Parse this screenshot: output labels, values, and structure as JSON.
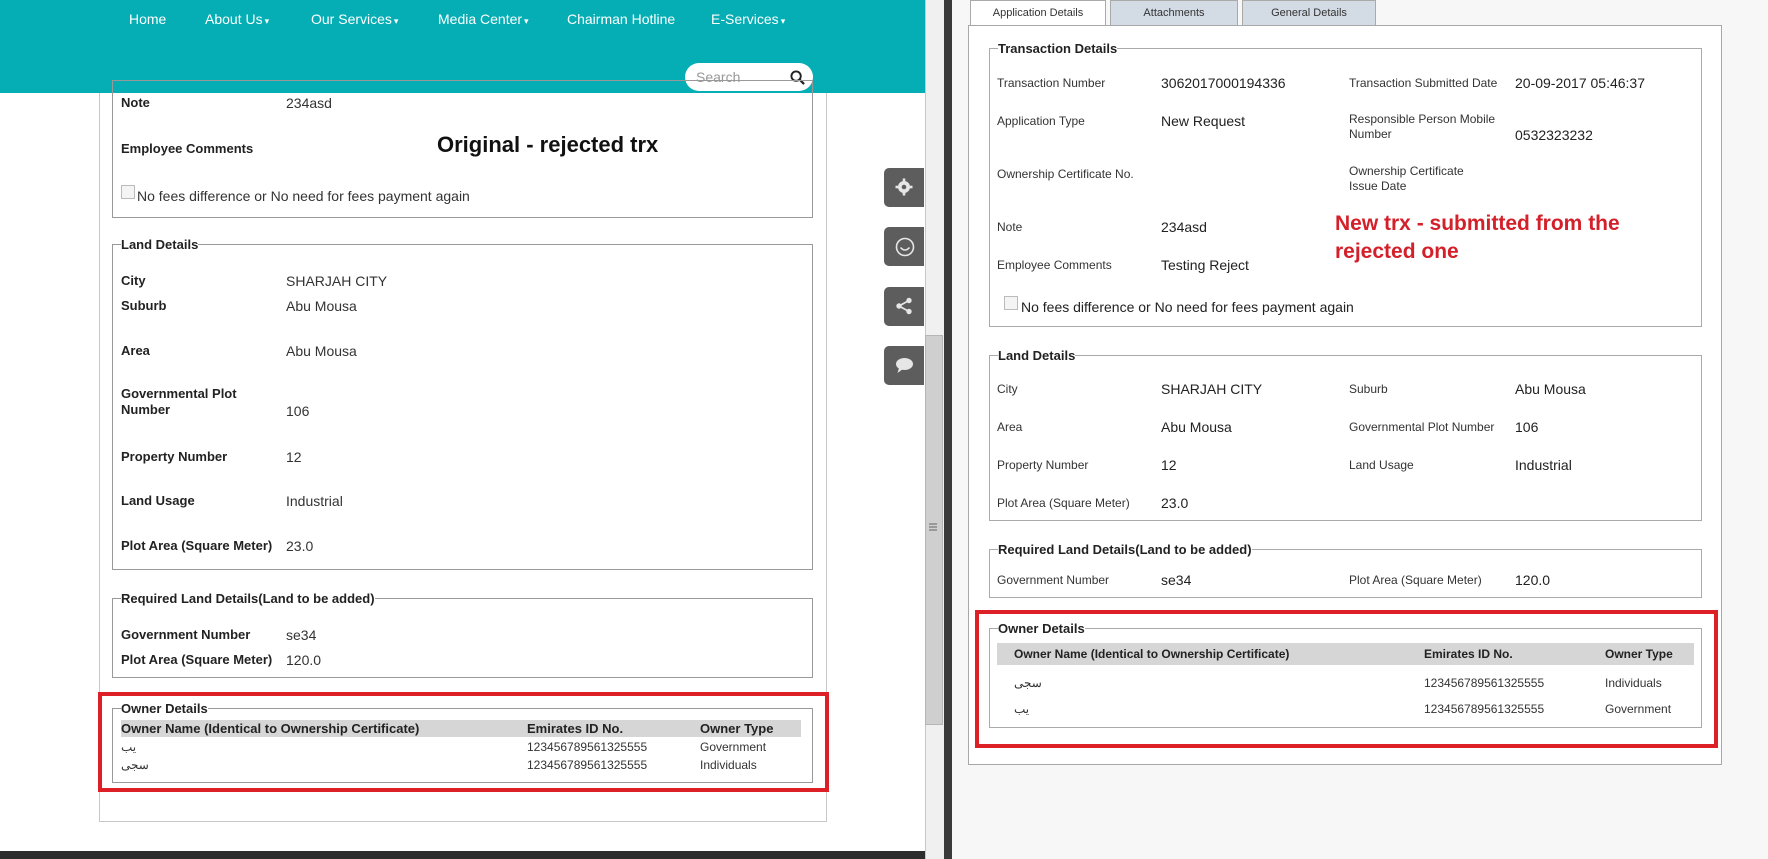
{
  "left": {
    "nav": {
      "items": [
        {
          "label": "Home",
          "caret": false
        },
        {
          "label": "About Us",
          "caret": true
        },
        {
          "label": "Our Services",
          "caret": true
        },
        {
          "label": "Media Center",
          "caret": true
        },
        {
          "label": "Chairman Hotline",
          "caret": false
        },
        {
          "label": "E-Services",
          "caret": true
        }
      ],
      "search_placeholder": "Search"
    },
    "app_section": {
      "note_label": "Note",
      "note_value": "234asd",
      "employee_comments_label": "Employee Comments",
      "fees_checkbox_label": "No fees difference or No need for fees payment again"
    },
    "annotation": "Original - rejected trx",
    "land_details": {
      "legend": "Land Details",
      "rows": [
        {
          "label": "City",
          "value": "SHARJAH CITY"
        },
        {
          "label": "Suburb",
          "value": "Abu Mousa"
        },
        {
          "label": "Area",
          "value": "Abu Mousa"
        },
        {
          "label": "Governmental Plot Number",
          "value": "106"
        },
        {
          "label": "Property Number",
          "value": "12"
        },
        {
          "label": "Land Usage",
          "value": "Industrial"
        },
        {
          "label": "Plot Area (Square Meter)",
          "value": "23.0"
        }
      ]
    },
    "required_land": {
      "legend": "Required Land Details(Land to be added)",
      "rows": [
        {
          "label": "Government Number",
          "value": "se34"
        },
        {
          "label": "Plot Area (Square Meter)",
          "value": "120.0"
        }
      ]
    },
    "owner_details": {
      "legend": "Owner Details",
      "columns": [
        "Owner Name (Identical to Ownership Certificate)",
        "Emirates ID No.",
        "Owner Type"
      ],
      "rows": [
        {
          "name": "يب",
          "id": "123456789561325555",
          "type": "Government"
        },
        {
          "name": "سجى",
          "id": "123456789561325555",
          "type": "Individuals"
        }
      ]
    }
  },
  "right": {
    "tabs": [
      "Application Details",
      "Attachments",
      "General Details"
    ],
    "transaction": {
      "legend": "Transaction Details",
      "transaction_number_label": "Transaction Number",
      "transaction_number": "3062017000194336",
      "submitted_date_label": "Transaction Submitted Date",
      "submitted_date": "20-09-2017 05:46:37",
      "application_type_label": "Application Type",
      "application_type": "New Request",
      "responsible_mobile_label": "Responsible Person Mobile Number",
      "responsible_mobile": "0532323232",
      "ownership_cert_label": "Ownership Certificate No.",
      "ownership_cert_date_label": "Ownership Certificate Issue Date",
      "note_label": "Note",
      "note_value": "234asd",
      "employee_comments_label": "Employee Comments",
      "employee_comments_value": "Testing Reject",
      "fees_checkbox_label": "No fees difference or No need for fees payment again"
    },
    "annotation": "New trx - submitted from the rejected one",
    "land_details": {
      "legend": "Land Details",
      "city_label": "City",
      "city": "SHARJAH CITY",
      "suburb_label": "Suburb",
      "suburb": "Abu Mousa",
      "area_label": "Area",
      "area": "Abu Mousa",
      "plot_number_label": "Governmental Plot Number",
      "plot_number": "106",
      "property_number_label": "Property Number",
      "property_number": "12",
      "land_usage_label": "Land Usage",
      "land_usage": "Industrial",
      "plot_area_label": "Plot Area (Square Meter)",
      "plot_area": "23.0"
    },
    "required_land": {
      "legend": "Required Land Details(Land to be added)",
      "gov_number_label": "Government Number",
      "gov_number": "se34",
      "plot_area_label": "Plot Area (Square Meter)",
      "plot_area": "120.0"
    },
    "owner_details": {
      "legend": "Owner Details",
      "columns": [
        "Owner Name (Identical to Ownership Certificate)",
        "Emirates ID No.",
        "Owner Type"
      ],
      "rows": [
        {
          "name": "سجى",
          "id": "123456789561325555",
          "type": "Individuals"
        },
        {
          "name": "يب",
          "id": "123456789561325555",
          "type": "Government"
        }
      ]
    }
  },
  "side_buttons": [
    "gear-icon",
    "smiley-icon",
    "share-icon",
    "chat-icon"
  ],
  "colors": {
    "nav_bg": "#04aeb4",
    "highlight_red": "#dd1f26",
    "annotation_red": "#d4202a"
  }
}
